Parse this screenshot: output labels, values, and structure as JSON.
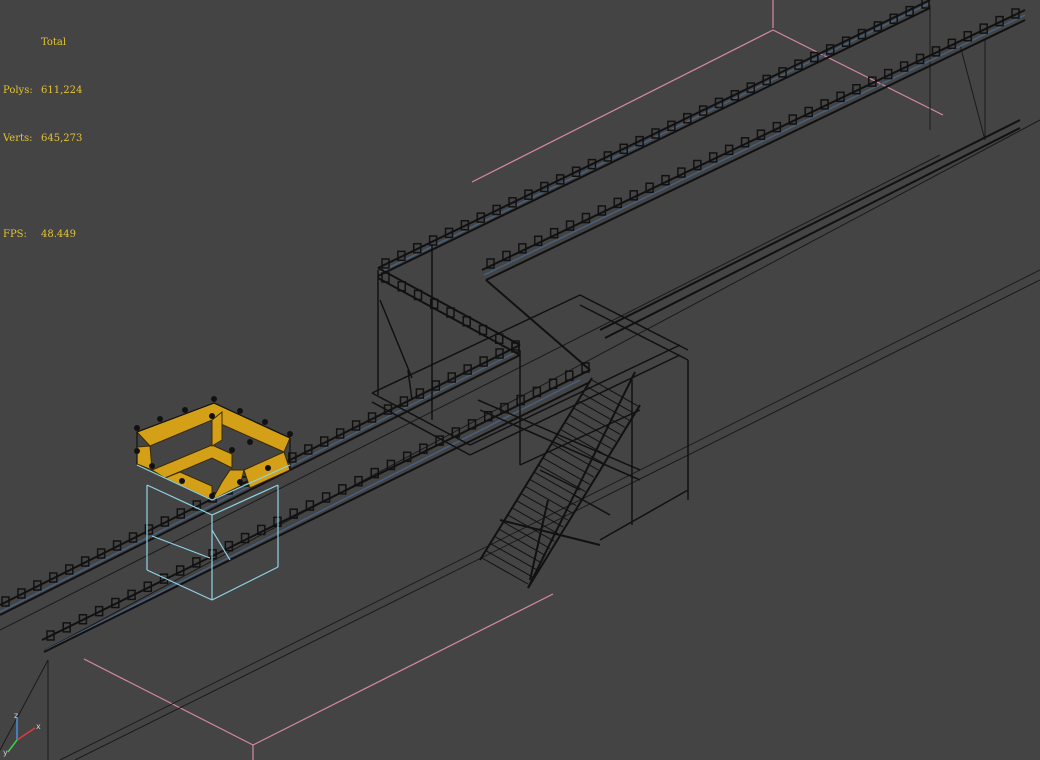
{
  "viewport": {
    "background": "#444444",
    "stats": {
      "header": "Total",
      "polys_label": "Polys:",
      "polys_value": "611,224",
      "verts_label": "Verts:",
      "verts_value": "645,273",
      "fps_label": "FPS:",
      "fps_value": "48.449",
      "color": "#e3c432"
    },
    "axis": {
      "x": "x",
      "y": "y",
      "z": "z"
    },
    "colors": {
      "wire": "#141414",
      "wire_blue": "#46607e",
      "grid_pink": "#d58aa5",
      "selected_fill": "#d4a017",
      "selected_box": "#8fd4e6"
    }
  }
}
